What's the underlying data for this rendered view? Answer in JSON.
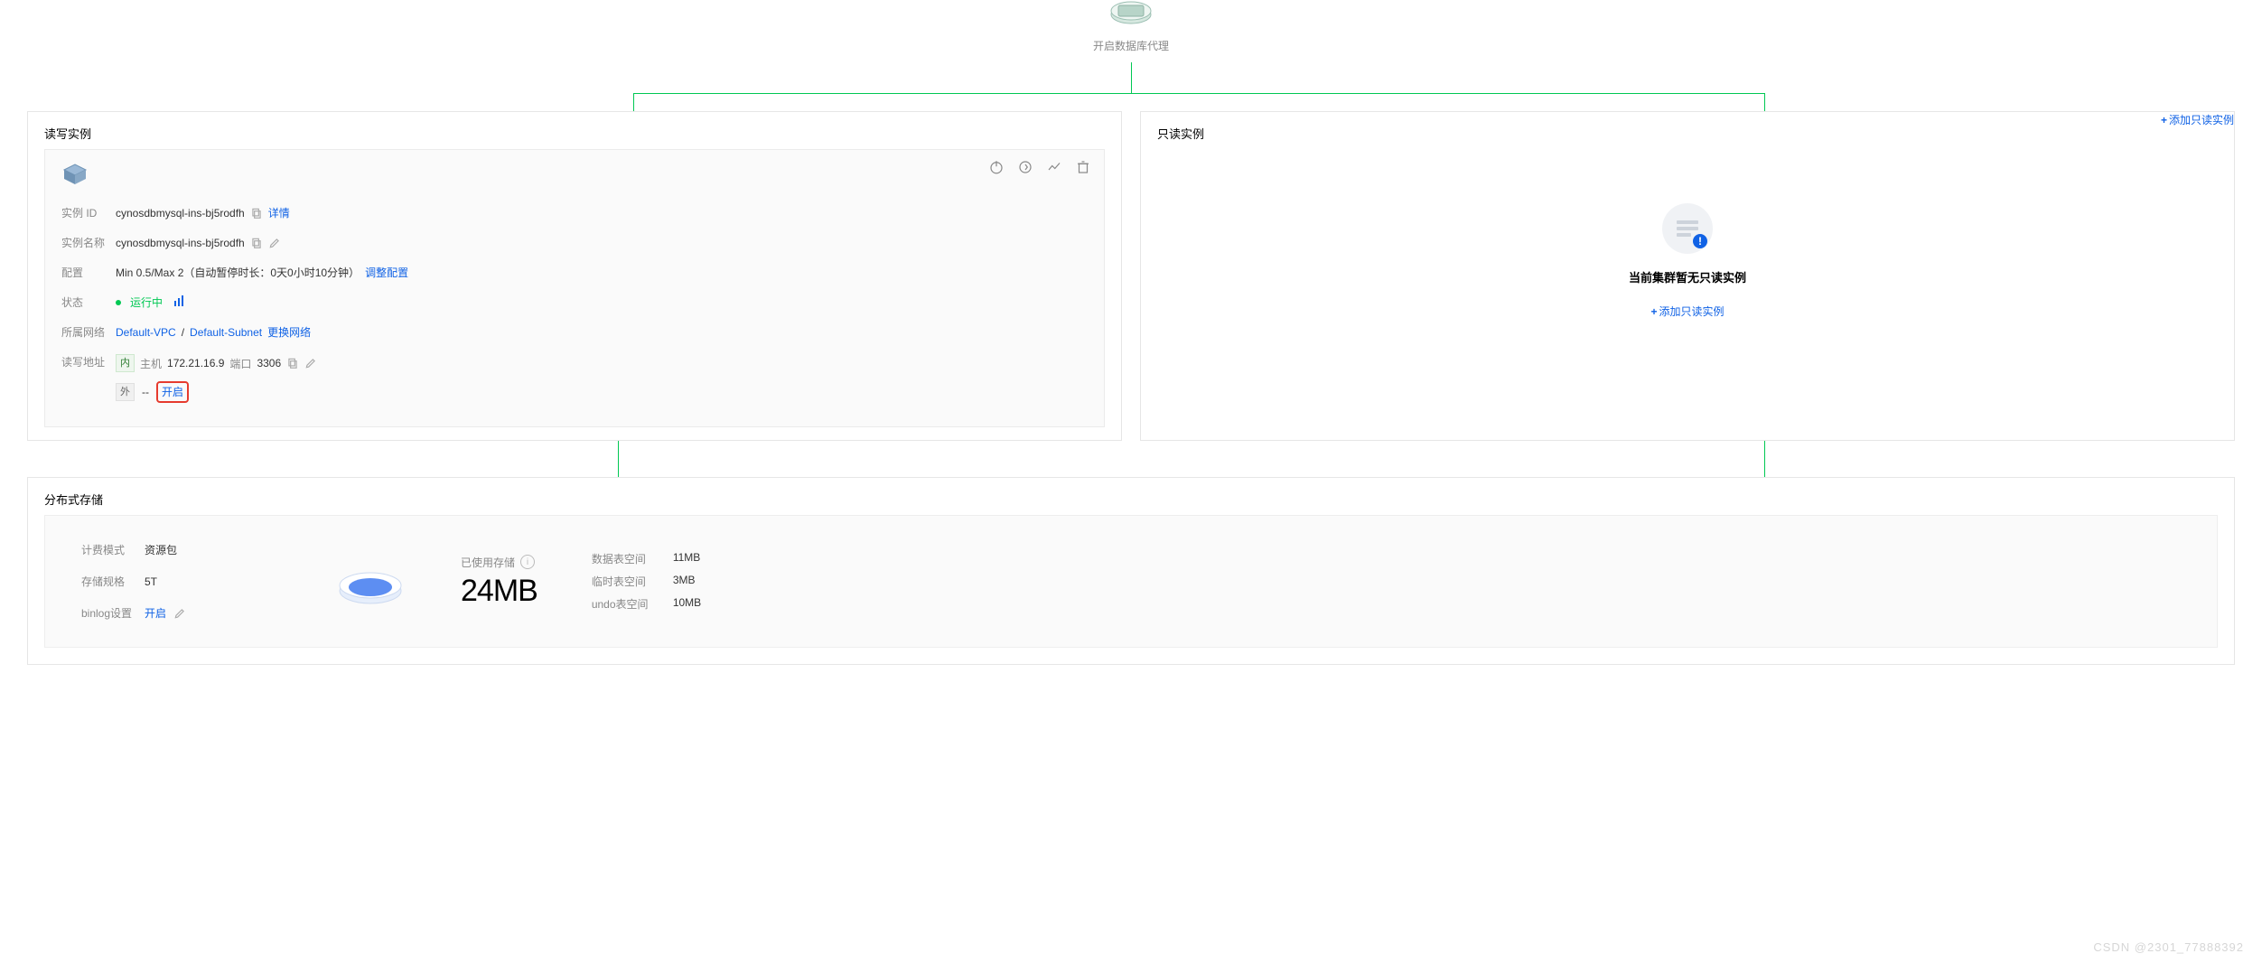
{
  "proxy": {
    "caption": "开启数据库代理"
  },
  "rw_panel": {
    "title": "读写实例",
    "rows": {
      "id_label": "实例 ID",
      "id_value": "cynosdbmysql-ins-bj5rodfh",
      "id_detail": "详情",
      "name_label": "实例名称",
      "name_value": "cynosdbmysql-ins-bj5rodfh",
      "config_label": "配置",
      "config_value": "Min 0.5/Max 2（自动暂停时长：0天0小时10分钟）",
      "config_adjust": "调整配置",
      "status_label": "状态",
      "status_value": "运行中",
      "network_label": "所属网络",
      "network_vpc": "Default-VPC",
      "network_subnet": "Default-Subnet",
      "network_change": "更换网络",
      "addr_label": "读写地址",
      "addr_inner_badge": "内",
      "addr_host_label": "主机",
      "addr_host_value": "172.21.16.9",
      "addr_port_label": "端口",
      "addr_port_value": "3306",
      "addr_outer_badge": "外",
      "addr_outer_dash": "--",
      "addr_open": "开启"
    }
  },
  "ro_panel": {
    "title": "只读实例",
    "add_link": "添加只读实例",
    "empty_title": "当前集群暂无只读实例",
    "empty_action": "添加只读实例"
  },
  "storage": {
    "title": "分布式存储",
    "billing_label": "计费模式",
    "billing_value": "资源包",
    "spec_label": "存储规格",
    "spec_value": "5T",
    "binlog_label": "binlog设置",
    "binlog_value": "开启",
    "used_label": "已使用存储",
    "used_value": "24MB",
    "breakdown": [
      {
        "label": "数据表空间",
        "value": "11MB"
      },
      {
        "label": "临时表空间",
        "value": "3MB"
      },
      {
        "label": "undo表空间",
        "value": "10MB"
      }
    ]
  },
  "watermark": "CSDN @2301_77888392"
}
